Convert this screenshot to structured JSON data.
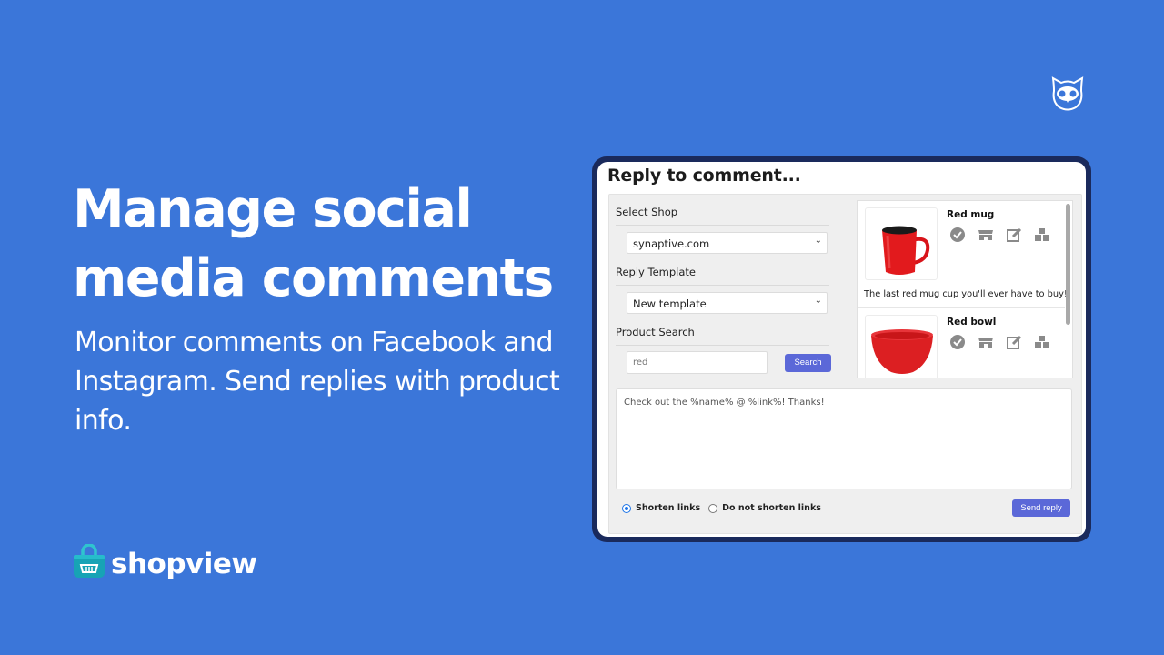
{
  "hero": {
    "title_line1": "Manage social",
    "title_line2": "media comments",
    "subtitle": "Monitor comments on Facebook and Instagram. Send replies with product info."
  },
  "brand": {
    "name": "shopview",
    "icon": "shopping-bag-basket-icon",
    "partner_icon": "owl-logo-icon"
  },
  "dialog": {
    "title": "Reply to comment...",
    "select_shop_label": "Select Shop",
    "shop_value": "synaptive.com",
    "reply_template_label": "Reply Template",
    "template_value": "New template",
    "product_search_label": "Product Search",
    "search_value": "red",
    "search_button": "Search",
    "products": [
      {
        "name": "Red mug",
        "description": "The last red mug cup you'll ever have to buy!",
        "icons": [
          "check-circle-icon",
          "store-icon",
          "edit-icon",
          "boxes-icon"
        ]
      },
      {
        "name": "Red bowl",
        "description": "",
        "icons": [
          "check-circle-icon",
          "store-icon",
          "edit-icon",
          "boxes-icon"
        ]
      }
    ],
    "reply_text": "Check out the %name% @ %link%! Thanks!",
    "link_options": [
      {
        "label": "Shorten links",
        "selected": true
      },
      {
        "label": "Do not shorten links",
        "selected": false
      }
    ],
    "send_button": "Send reply"
  },
  "colors": {
    "background": "#3b76d9",
    "frame": "#1a2a5c",
    "button": "#5b68d8"
  }
}
